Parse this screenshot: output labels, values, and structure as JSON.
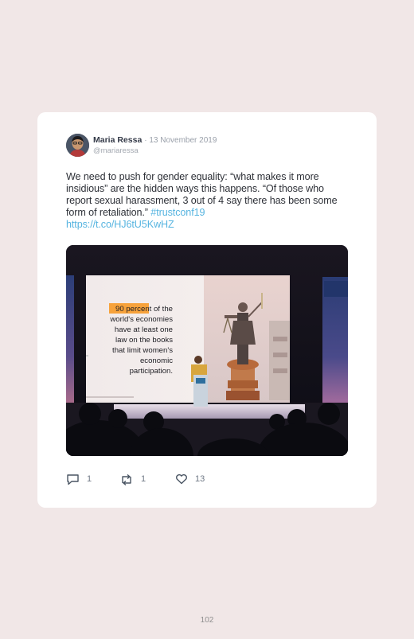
{
  "tweet": {
    "author_name": "Maria Ressa",
    "date": "· 13 November 2019",
    "handle": "@mariaressa",
    "text_main": "We need to push for gender equality: “what makes it more insidious” are the hidden ways this happens. “Of those who report sexual harassment, 3 out of 4 say there has been some form of retaliation.” ",
    "hashtag": "#trustconf19",
    "link": "https://t.co/HJ6tU5KwHZ",
    "slide": {
      "highlight": "90 percent",
      "line1_rest": " of the",
      "line2": "world's economies",
      "line3": "have at least one",
      "line4": "law on the books",
      "line5": "that limit women's",
      "line6": "economic",
      "line7": "participation."
    },
    "replies": "1",
    "retweets": "1",
    "likes": "13"
  },
  "page_number": "102",
  "colors": {
    "background": "#f1e7e7",
    "card": "#ffffff",
    "link": "#56b4e0",
    "highlight": "#f7a23b"
  },
  "icons": [
    "reply-icon",
    "retweet-icon",
    "like-icon"
  ]
}
